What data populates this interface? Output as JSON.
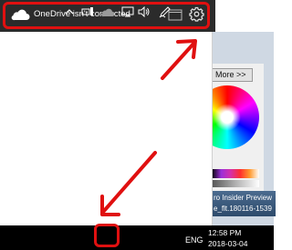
{
  "onedrive": {
    "title": "OneDrive isn't connected",
    "icons": {
      "cloud": "cloud-icon",
      "folder": "folder-icon",
      "settings": "gear-icon"
    }
  },
  "background_window": {
    "more_button_label": "More >>",
    "insider_label": "ro Insider Preview",
    "build_label": "e_flt.180116-1539"
  },
  "taskbar": {
    "language": "ENG",
    "time": "12:58 PM",
    "date": "2018-03-04",
    "icons": [
      "chevron-up-icon",
      "onedrive-tray-icon",
      "display-icon",
      "volume-icon",
      "pen-icon",
      "notification-icon"
    ]
  },
  "annotation_color": "#e01010",
  "header_color": "#2b2b2b"
}
